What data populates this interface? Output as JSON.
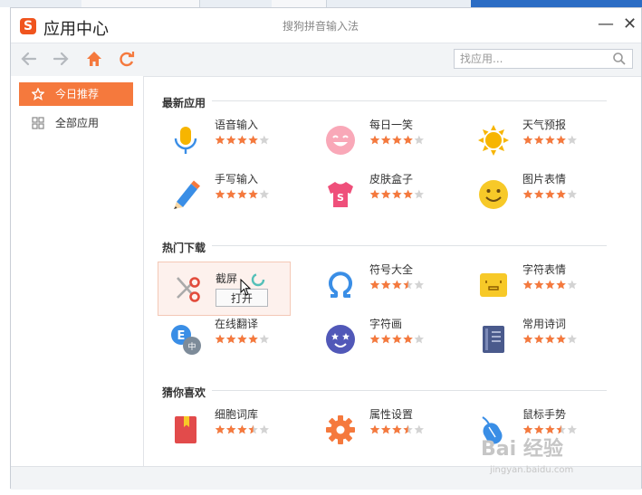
{
  "window": {
    "logo_text": "S",
    "app_title": "应用中心",
    "center_title": "搜狗拼音输入法",
    "minimize_label": "—",
    "close_label": "✕"
  },
  "toolbar": {
    "back_icon": "back-arrow-icon",
    "forward_icon": "forward-arrow-icon",
    "home_icon": "home-icon",
    "refresh_icon": "refresh-icon",
    "search_placeholder": "找应用...",
    "search_value": ""
  },
  "sidebar": {
    "items": [
      {
        "label": "今日推荐",
        "icon": "star-icon",
        "active": true
      },
      {
        "label": "全部应用",
        "icon": "grid-icon",
        "active": false
      }
    ]
  },
  "sections": [
    {
      "title": "最新应用",
      "apps": [
        {
          "name": "语音输入",
          "icon": "microphone-icon",
          "rating": 4
        },
        {
          "name": "每日一笑",
          "icon": "smiley-face-icon",
          "rating": 4
        },
        {
          "name": "天气预报",
          "icon": "sun-icon",
          "rating": 4
        },
        {
          "name": "手写输入",
          "icon": "pencil-icon",
          "rating": 4
        },
        {
          "name": "皮肤盒子",
          "icon": "tshirt-icon",
          "rating": 4
        },
        {
          "name": "图片表情",
          "icon": "emoji-face-icon",
          "rating": 4
        }
      ]
    },
    {
      "title": "热门下载",
      "apps": [
        {
          "name": "截屏",
          "icon": "scissors-icon",
          "rating": 4,
          "hover_button": "打开"
        },
        {
          "name": "符号大全",
          "icon": "omega-icon",
          "rating": 3.5
        },
        {
          "name": "字符表情",
          "icon": "character-face-icon",
          "rating": 4
        },
        {
          "name": "在线翻译",
          "icon": "translate-icon",
          "rating": 4
        },
        {
          "name": "字符画",
          "icon": "star-face-icon",
          "rating": 4
        },
        {
          "name": "常用诗词",
          "icon": "book-icon",
          "rating": 4
        }
      ]
    },
    {
      "title": "猜你喜欢",
      "apps": [
        {
          "name": "细胞词库",
          "icon": "bookmark-book-icon",
          "rating": 3.5
        },
        {
          "name": "属性设置",
          "icon": "gear-icon",
          "rating": 3.5
        },
        {
          "name": "鼠标手势",
          "icon": "mouse-icon",
          "rating": 3.5
        }
      ]
    }
  ],
  "watermark": {
    "line1": "Bai 经验",
    "line2": "jingyan.baidu.com"
  },
  "colors": {
    "accent": "#f5793d",
    "star_on": "#f5793d",
    "star_off": "#d3d3d3",
    "brand": "#f0541e"
  }
}
